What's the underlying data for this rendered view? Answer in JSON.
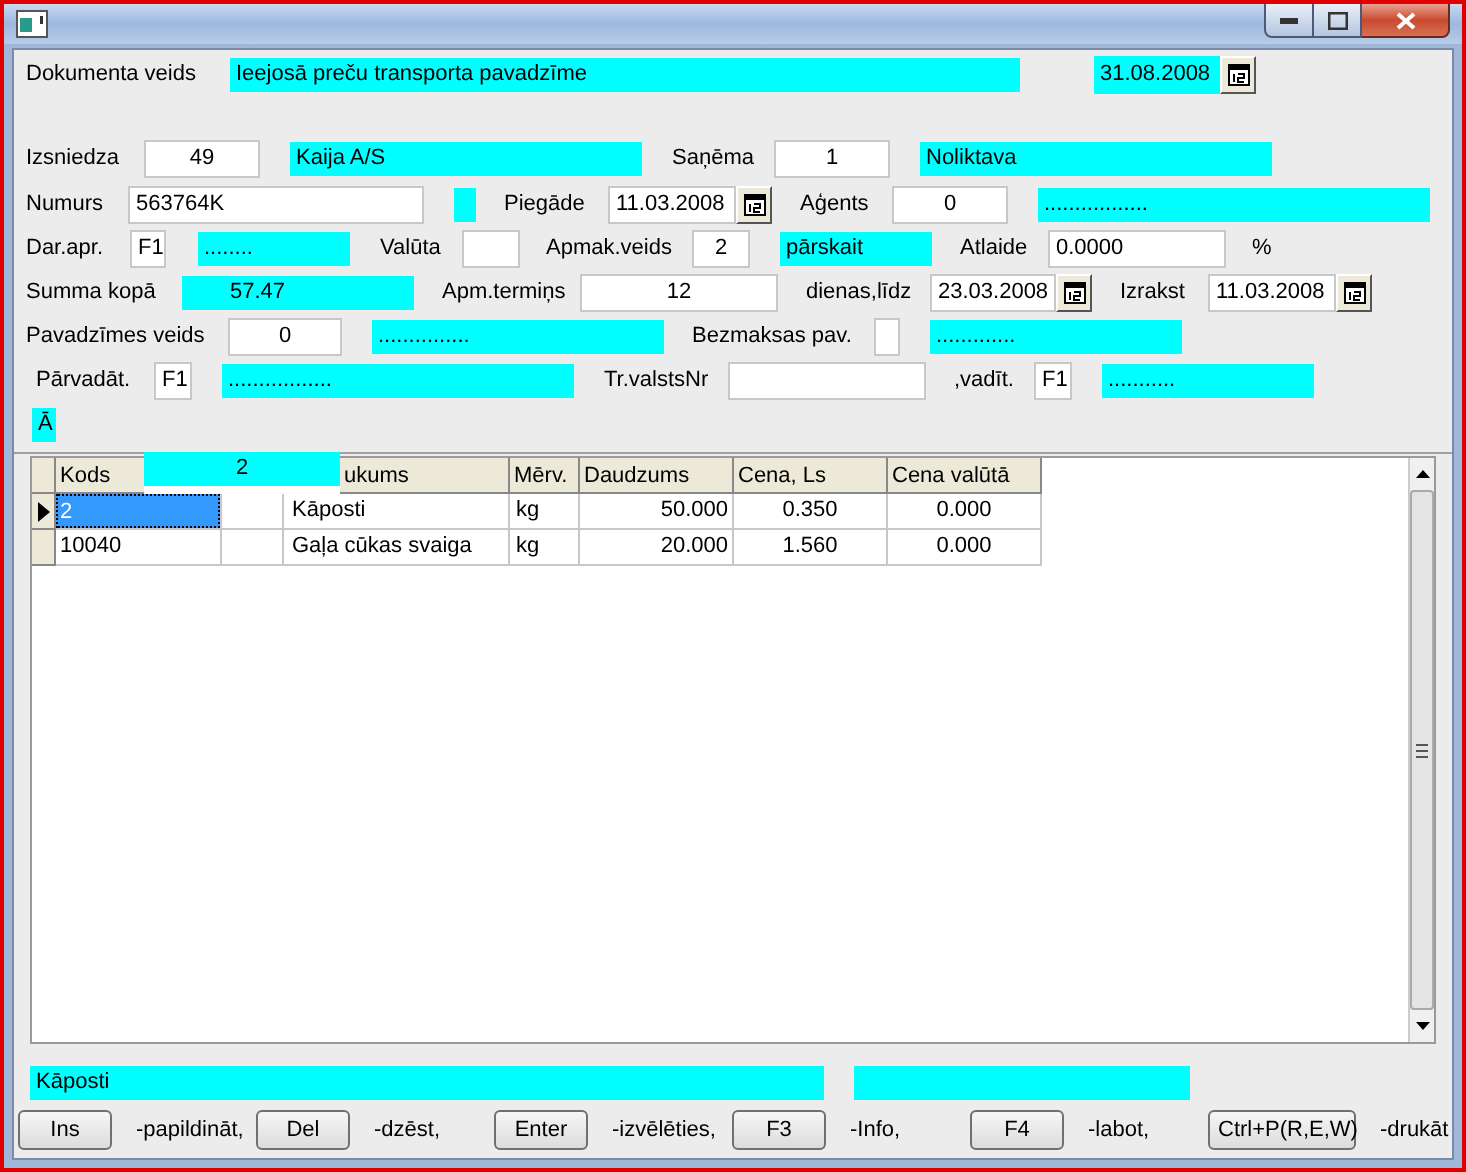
{
  "form_rows": [
    [
      {
        "kind": "label",
        "text": "Dokumenta veids"
      },
      {
        "kind": "lookup",
        "text": "Ieejosā preču transporta pavadzīme"
      },
      {
        "kind": "date",
        "text": "31.08.2008",
        "highlight": true
      }
    ],
    [
      {
        "kind": "label",
        "text": "Izsniedza"
      },
      {
        "kind": "input",
        "text": "49"
      },
      {
        "kind": "lookup",
        "text": "Kaija A/S"
      },
      {
        "kind": "label",
        "text": "Saņēma"
      },
      {
        "kind": "input",
        "text": "1"
      },
      {
        "kind": "lookup",
        "text": "Noliktava"
      }
    ],
    [
      {
        "kind": "label",
        "text": "Numurs"
      },
      {
        "kind": "input",
        "text": "563764K"
      },
      {
        "kind": "lookup"
      },
      {
        "kind": "label",
        "text": "Piegāde"
      },
      {
        "kind": "date",
        "text": "11.03.2008",
        "highlight": false
      },
      {
        "kind": "label",
        "text": "Aģents"
      },
      {
        "kind": "input",
        "text": "0"
      },
      {
        "kind": "lookup",
        "text": "................."
      }
    ],
    [
      {
        "kind": "label",
        "text": "Dar.apr."
      },
      {
        "kind": "input",
        "text": "F1"
      },
      {
        "kind": "lookup",
        "text": "........"
      },
      {
        "kind": "label",
        "text": "Valūta"
      },
      {
        "kind": "input"
      },
      {
        "kind": "label",
        "text": "Apmak.veids"
      },
      {
        "kind": "input",
        "text": "2"
      },
      {
        "kind": "lookup",
        "text": "pārskait"
      },
      {
        "kind": "label",
        "text": "Atlaide"
      },
      {
        "kind": "input",
        "text": "0.0000"
      },
      {
        "kind": "label",
        "text": "%"
      }
    ],
    [
      {
        "kind": "label",
        "text": "Summa kopā"
      },
      {
        "kind": "lookup",
        "text": "57.47"
      },
      {
        "kind": "label",
        "text": "Apm.termiņs"
      },
      {
        "kind": "input",
        "text": "12"
      },
      {
        "kind": "label",
        "text": "dienas,līdz"
      },
      {
        "kind": "date",
        "text": "23.03.2008",
        "highlight": false
      },
      {
        "kind": "label",
        "text": "Izrakst"
      },
      {
        "kind": "date",
        "text": "11.03.2008",
        "highlight": false
      }
    ],
    [
      {
        "kind": "label",
        "text": "Pavadzīmes veids"
      },
      {
        "kind": "input",
        "text": "0"
      },
      {
        "kind": "lookup",
        "text": "..............."
      },
      {
        "kind": "label",
        "text": "Bezmaksas pav."
      },
      {
        "kind": "input"
      },
      {
        "kind": "lookup",
        "text": "............."
      }
    ],
    [
      {
        "kind": "label",
        "text": "Pārvadāt."
      },
      {
        "kind": "input",
        "text": "F1"
      },
      {
        "kind": "lookup",
        "text": "................."
      },
      {
        "kind": "label",
        "text": "Tr.valstsNr"
      },
      {
        "kind": "input"
      },
      {
        "kind": "label",
        "text": ",vadīt."
      },
      {
        "kind": "input",
        "text": "F1"
      },
      {
        "kind": "lookup",
        "text": "..........."
      }
    ],
    [
      {
        "kind": "lookup",
        "text": "Ā"
      }
    ]
  ],
  "grid_editor": {
    "value": "2"
  },
  "grid": {
    "columns": [
      "Kods",
      "ukums",
      "Mērv.",
      "Daudzums",
      "Cena, Ls",
      "Cena valūtā"
    ],
    "rows": [
      {
        "selected": true,
        "kods": "2",
        "column_3": "Kāposti",
        "merv": "kg",
        "daudzums": "50.000",
        "cena_ls": "0.350",
        "cena_valuta": "0.000"
      },
      {
        "selected": false,
        "kods": "10040",
        "column_3": "Gaļa cūkas svaiga",
        "merv": "kg",
        "daudzums": "20.000",
        "cena_ls": "1.560",
        "cena_valuta": "0.000"
      }
    ]
  },
  "status_fields": [
    {
      "text": "Kāposti"
    }
  ],
  "actions": [
    {
      "key": "Ins",
      "hint": "-papildināt,"
    },
    {
      "key": "Del",
      "hint": "-dzēst,"
    },
    {
      "key": "Enter",
      "hint": "-izvēlēties,"
    },
    {
      "key": "F3",
      "hint": "-Info,"
    },
    {
      "key": "F4",
      "hint": "-labot,"
    },
    {
      "key": "Ctrl+P(R,E,W)",
      "hint": "-drukāt"
    }
  ]
}
